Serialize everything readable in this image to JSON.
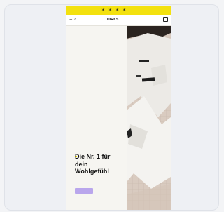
{
  "announcement": {
    "text": "",
    "icons": [
      "star-icon",
      "star-icon",
      "star-icon",
      "star-icon"
    ]
  },
  "nav": {
    "menu_icon": "menu-icon",
    "search_icon": "search-icon",
    "logo": "DIRKS",
    "cart_icon": "cart-icon"
  },
  "hero": {
    "eyebrow": "",
    "headline": "Die Nr. 1 für dein Wohlgefühl",
    "subtext": "",
    "cta_label": "",
    "image_alt_icon": "apparel-photo"
  },
  "colors": {
    "announcement_bg": "#f3e10e",
    "cta_bg": "#b9a6ec",
    "background": "#f6f5f1"
  }
}
